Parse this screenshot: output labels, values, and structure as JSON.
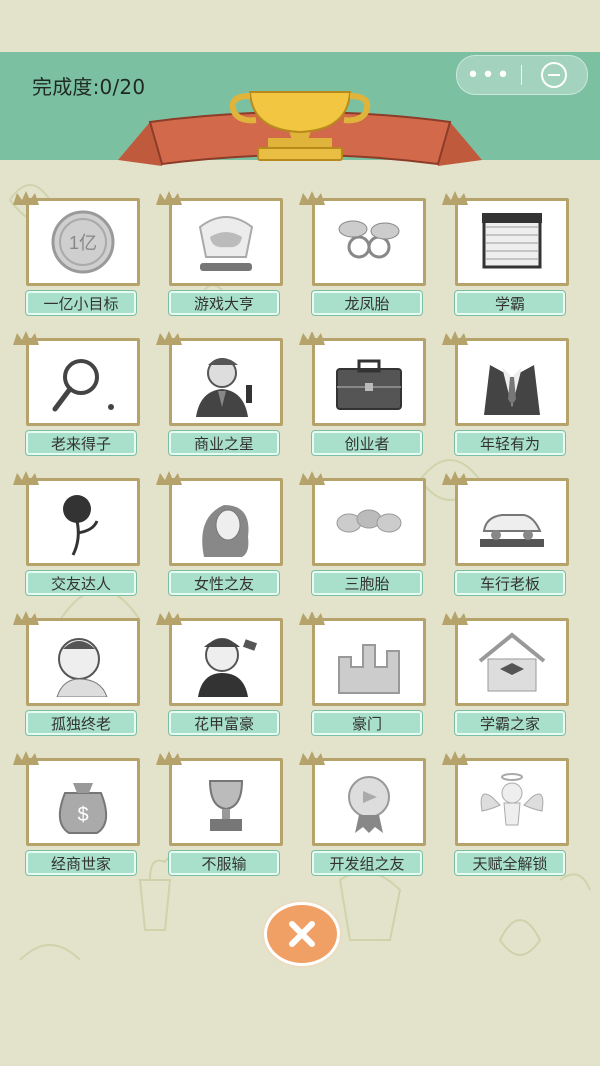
{
  "header": {
    "progress_text": "完成度:0/20",
    "capsule_more": "•••",
    "band_color": "#7cc0a2"
  },
  "achievements": [
    {
      "label": "一亿小目标",
      "icon": "coin-icon",
      "coin_text": "1亿"
    },
    {
      "label": "游戏大亨",
      "icon": "gamepad-trophy-icon"
    },
    {
      "label": "龙凤胎",
      "icon": "pacifiers-icon"
    },
    {
      "label": "学霸",
      "icon": "book-stack-icon"
    },
    {
      "label": "老来得子",
      "icon": "magnifier-icon"
    },
    {
      "label": "商业之星",
      "icon": "businessman-icon"
    },
    {
      "label": "创业者",
      "icon": "briefcase-icon"
    },
    {
      "label": "年轻有为",
      "icon": "suit-icon"
    },
    {
      "label": "交友达人",
      "icon": "rose-icon"
    },
    {
      "label": "女性之友",
      "icon": "woman-icon"
    },
    {
      "label": "三胞胎",
      "icon": "three-pacifiers-icon"
    },
    {
      "label": "车行老板",
      "icon": "car-icon"
    },
    {
      "label": "孤独终老",
      "icon": "old-man-icon"
    },
    {
      "label": "花甲富豪",
      "icon": "rich-elder-icon"
    },
    {
      "label": "豪门",
      "icon": "castle-icon"
    },
    {
      "label": "学霸之家",
      "icon": "house-gradcap-icon"
    },
    {
      "label": "经商世家",
      "icon": "money-bag-icon"
    },
    {
      "label": "不服输",
      "icon": "trophy-cup-icon"
    },
    {
      "label": "开发组之友",
      "icon": "medal-icon"
    },
    {
      "label": "天赋全解锁",
      "icon": "angel-icon"
    }
  ],
  "footer": {
    "close_icon": "close-icon",
    "close_color": "#f0a064"
  }
}
